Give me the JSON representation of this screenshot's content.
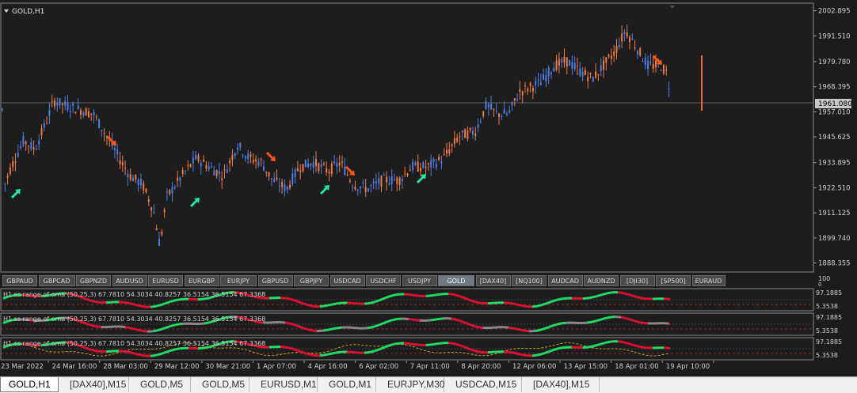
{
  "main": {
    "title": "GOLD,H1",
    "current_price": "1961.080",
    "price_range": [
      1886.4,
      2004.9
    ],
    "y_ticks": [
      "2002.895",
      "1991.510",
      "1979.780",
      "1968.395",
      "1957.010",
      "1945.625",
      "1933.895",
      "1922.510",
      "1911.125",
      "1899.740",
      "1888.355"
    ]
  },
  "symbols": [
    "GBPAUD",
    "GBPCAD",
    "GBPNZD",
    "AUDUSD",
    "EURUSD",
    "EURGBP",
    "EURJPY",
    "GBPUSD",
    "GBPJPY",
    "USDCAD",
    "USDCHF",
    "USDJPY",
    "GOLD",
    "[DAX40]",
    "[NQ100]",
    "AUDCAD",
    "AUDNZD",
    "[DJI30]",
    "[SP500]",
    "EURAUD"
  ],
  "active_symbol": "GOLD",
  "indicator": {
    "label": "H1   ss range of oma (50,25,3) 67.7810 54.3034 40.8257 36.5154 36.5154 67.3368",
    "top_value": "97.1885",
    "bottom_value": "5.3538",
    "scale_top": "100",
    "scale_bottom": "0"
  },
  "x_ticks": [
    "23 Mar 2022",
    "24 Mar 16:00",
    "28 Mar 03:00",
    "29 Mar 12:00",
    "30 Mar 21:00",
    "1 Apr 07:00",
    "4 Apr 16:00",
    "6 Apr 02:00",
    "7 Apr 11:00",
    "8 Apr 20:00",
    "12 Apr 06:00",
    "13 Apr 15:00",
    "18 Apr 01:00",
    "19 Apr 10:00"
  ],
  "tabs": [
    "GOLD,H1",
    "[DAX40],M15",
    "GOLD,M5",
    "GOLD,M5",
    "EURUSD,M1",
    "GOLD,M1",
    "EURJPY,M30",
    "USDCAD,M15",
    "[DAX40],M15"
  ],
  "active_tab": "GOLD,H1",
  "colors": {
    "bull": "#4a7ee6",
    "bear": "#ef7b3c",
    "up_arrow": "#22e6a0",
    "down_arrow": "#ff5511",
    "osc_up": "#22dd66",
    "osc_down": "#dd1133",
    "osc_neutral": "#888888"
  }
}
